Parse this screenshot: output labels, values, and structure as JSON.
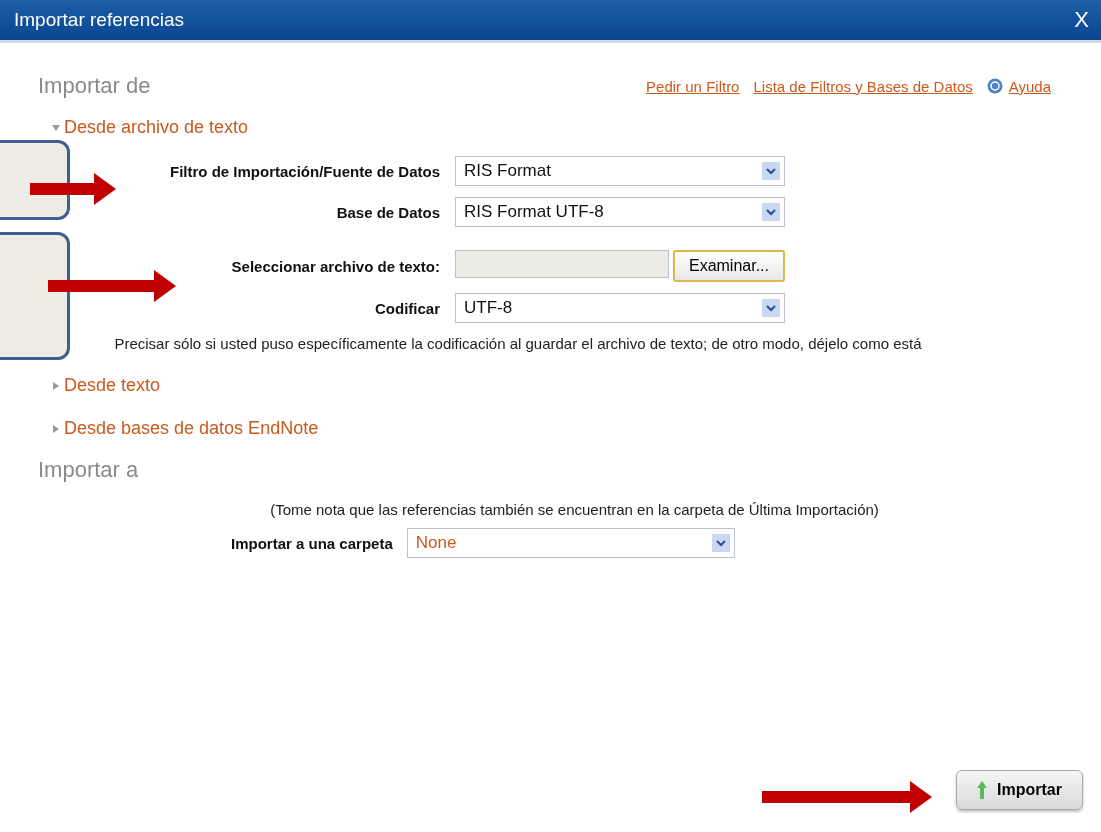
{
  "window": {
    "title": "Importar referencias",
    "close": "X"
  },
  "import_from": {
    "heading": "Importar de",
    "links": [
      {
        "kind": "link",
        "label": "Pedir un Filtro"
      },
      {
        "kind": "link",
        "label": "Lista de Filtros y Bases de Datos"
      },
      {
        "kind": "help",
        "label": "Ayuda"
      }
    ],
    "sections": [
      {
        "label": "Desde archivo de texto",
        "expanded": true,
        "fields": [
          {
            "kind": "select",
            "label": "Filtro de Importación/Fuente de Datos",
            "value": "RIS Format"
          },
          {
            "kind": "select",
            "label": "Base de Datos",
            "value": "RIS Format UTF-8"
          },
          {
            "kind": "file",
            "label": "Seleccionar archivo de texto:",
            "button": "Examinar..."
          },
          {
            "kind": "select",
            "label": "Codificar",
            "value": "UTF-8"
          }
        ],
        "hint": "Precisar sólo si usted puso específicamente la codificación al guardar el archivo de texto; de otro modo, déjelo como está"
      },
      {
        "label": "Desde texto",
        "expanded": false
      },
      {
        "label": "Desde bases de datos EndNote",
        "expanded": false
      }
    ]
  },
  "import_to": {
    "heading": "Importar a",
    "note": "(Tome nota que las referencias también se encuentran en la carpeta de Última Importación)",
    "field": {
      "label": "Importar a una carpeta",
      "value": "None"
    }
  },
  "submit": {
    "label": "Importar"
  }
}
